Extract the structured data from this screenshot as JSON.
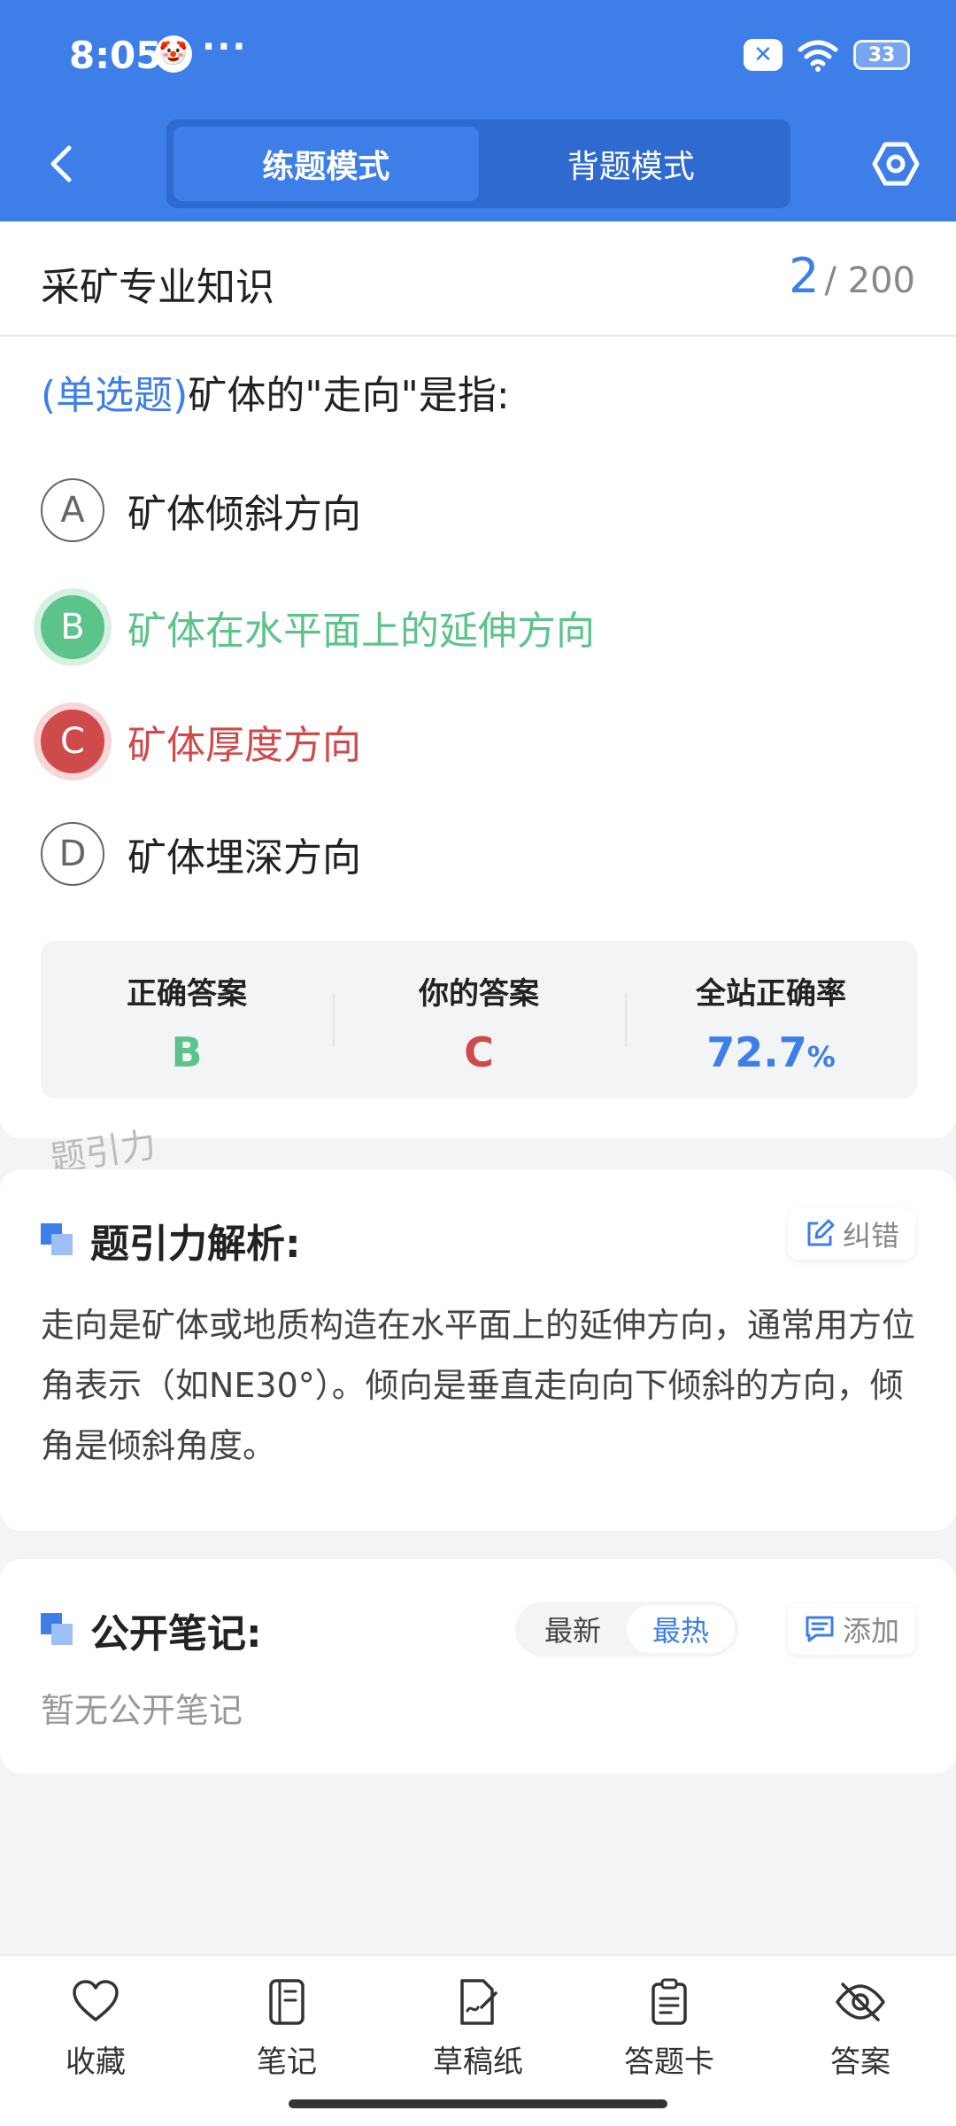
{
  "status_bar": {
    "time": "8:05",
    "more": "···",
    "battery": "33"
  },
  "nav": {
    "tabs": [
      "练题模式",
      "背题模式"
    ],
    "active_tab": 0
  },
  "subject": {
    "title": "采矿专业知识",
    "current": "2",
    "total": "/ 200"
  },
  "question": {
    "type": "(单选题)",
    "text": "矿体的\"走向\"是指:"
  },
  "options": [
    {
      "letter": "A",
      "text": "矿体倾斜方向",
      "state": "normal"
    },
    {
      "letter": "B",
      "text": "矿体在水平面上的延伸方向",
      "state": "correct"
    },
    {
      "letter": "C",
      "text": "矿体厚度方向",
      "state": "wrong"
    },
    {
      "letter": "D",
      "text": "矿体埋深方向",
      "state": "normal"
    }
  ],
  "stats": {
    "correct_label": "正确答案",
    "correct_value": "B",
    "your_label": "你的答案",
    "your_value": "C",
    "rate_label": "全站正确率",
    "rate_value": "72.7",
    "rate_unit": "%"
  },
  "watermark": "题引力",
  "analysis": {
    "title": "题引力解析:",
    "fix_label": "纠错",
    "text": "走向是矿体或地质构造在水平面上的延伸方向，通常用方位角表示（如NE30°）。倾向是垂直走向向下倾斜的方向，倾角是倾斜角度。"
  },
  "notes": {
    "title": "公开笔记:",
    "sort_options": [
      "最新",
      "最热"
    ],
    "active_sort": 1,
    "add_label": "添加",
    "empty_text": "暂无公开笔记"
  },
  "bottom_tabs": [
    {
      "label": "收藏",
      "icon": "heart-icon"
    },
    {
      "label": "笔记",
      "icon": "notebook-icon"
    },
    {
      "label": "草稿纸",
      "icon": "draft-paper-icon"
    },
    {
      "label": "答题卡",
      "icon": "answer-sheet-icon"
    },
    {
      "label": "答案",
      "icon": "eye-off-icon"
    }
  ],
  "colors": {
    "primary": "#3d7ee9",
    "correct": "#5cc38a",
    "wrong": "#cf4a4a"
  }
}
